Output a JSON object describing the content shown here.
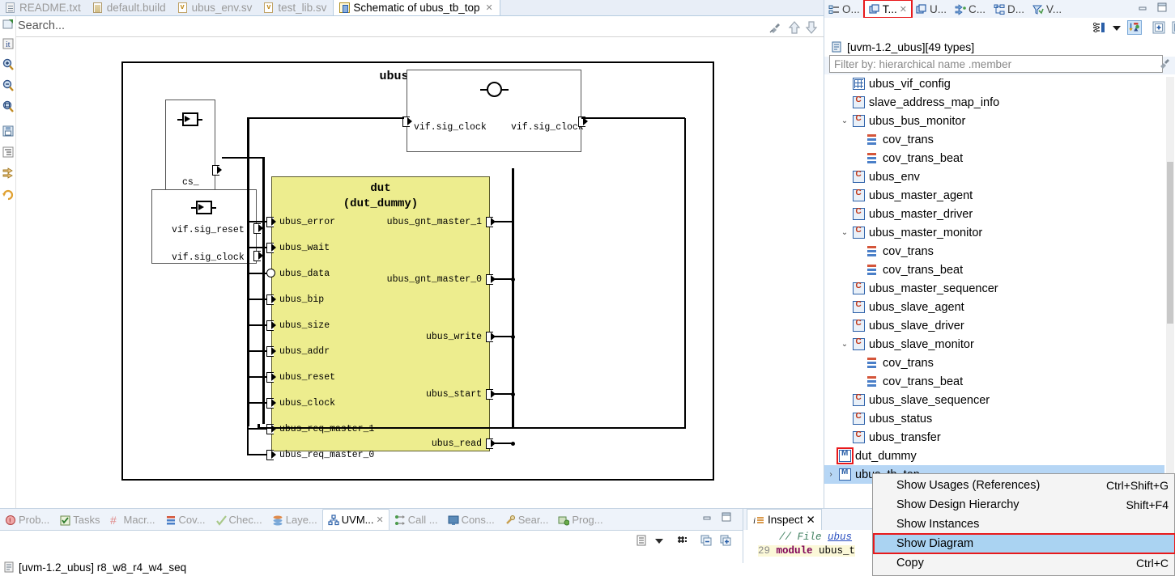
{
  "editor": {
    "tabs": [
      {
        "label": "README.txt",
        "icon": "text-file-icon",
        "active": false,
        "closable": false
      },
      {
        "label": "default.build",
        "icon": "build-file-icon",
        "active": false,
        "closable": false
      },
      {
        "label": "ubus_env.sv",
        "icon": "systemverilog-file-icon",
        "active": false,
        "closable": false
      },
      {
        "label": "test_lib.sv",
        "icon": "systemverilog-file-icon",
        "active": false,
        "closable": false
      },
      {
        "label": "Schematic of ubus_tb_top",
        "icon": "schematic-icon",
        "active": true,
        "closable": true
      }
    ],
    "search_placeholder": "Search...",
    "toolbar_icons": [
      "pin-icon",
      "arrow-up-icon",
      "arrow-down-icon"
    ],
    "left_tools": [
      "pin-editor-icon",
      "info-icon",
      "zoom-in-icon",
      "zoom-out-icon",
      "zoom-fit-icon",
      "save-icon",
      "outline-icon",
      "expand-icon",
      "refresh-icon"
    ]
  },
  "schematic": {
    "title": "ubus_tb_top",
    "dut": {
      "name": "dut",
      "type": "(dut_dummy)",
      "inputs": [
        "ubus_error",
        "ubus_wait",
        "ubus_data",
        "ubus_bip",
        "ubus_size",
        "ubus_addr",
        "ubus_reset",
        "ubus_clock",
        "ubus_req_master_1",
        "ubus_req_master_0"
      ],
      "outputs": [
        "ubus_gnt_master_1",
        "ubus_gnt_master_0",
        "ubus_write",
        "ubus_start",
        "ubus_read"
      ]
    },
    "blocks": [
      {
        "id": "cs-block",
        "symbol": "interface-icon",
        "labels": [
          "cs_"
        ]
      },
      {
        "id": "vif-block",
        "symbol": "interface-icon",
        "labels": [
          "vif.sig_reset",
          "vif.sig_clock"
        ]
      },
      {
        "id": "clock-block",
        "symbol": "clock-icon",
        "labels_left": [
          "vif.sig_clock"
        ],
        "labels_right": [
          "vif.sig_clock"
        ]
      }
    ],
    "dut_fill_color": "#eded8e"
  },
  "bottom": {
    "tabs": [
      {
        "label": "Prob...",
        "icon": "problems-icon",
        "active": false
      },
      {
        "label": "Tasks",
        "icon": "tasks-icon",
        "active": false
      },
      {
        "label": "Macr...",
        "icon": "macros-icon",
        "active": false
      },
      {
        "label": "Cov...",
        "icon": "coverage-icon",
        "active": false
      },
      {
        "label": "Chec...",
        "icon": "checks-icon",
        "active": false
      },
      {
        "label": "Laye...",
        "icon": "layers-icon",
        "active": false
      },
      {
        "label": "UVM...",
        "icon": "uvm-icon",
        "active": true
      },
      {
        "label": "Call ...",
        "icon": "call-hierarchy-icon",
        "active": false
      },
      {
        "label": "Cons...",
        "icon": "console-icon",
        "active": false
      },
      {
        "label": "Sear...",
        "icon": "search-icon",
        "active": false
      },
      {
        "label": "Prog...",
        "icon": "progress-icon",
        "active": false
      }
    ],
    "toolbar_icons": [
      "list-view-icon",
      "chevron-down-icon",
      "grid-icon",
      "collapse-all-icon",
      "expand-all-icon"
    ],
    "window_icons": [
      "minimize-icon",
      "maximize-icon"
    ]
  },
  "inspect": {
    "tab_label": "Inspect",
    "tab_icon": "inspect-icon",
    "code": {
      "comment": "// File ",
      "comment_link": "ubus",
      "line_number": "29",
      "keyword": "module",
      "rest": " ubus_t"
    }
  },
  "status": {
    "icon": "project-icon",
    "text": "[uvm-1.2_ubus] r8_w8_r4_w4_seq"
  },
  "right_panel": {
    "tabs": [
      {
        "label": "O...",
        "icon": "outline-icon",
        "active": false,
        "closable": false
      },
      {
        "label": "T...",
        "icon": "types-icon",
        "active": true,
        "closable": true
      },
      {
        "label": "U...",
        "icon": "uvm-types-icon",
        "active": false,
        "closable": false
      },
      {
        "label": "C...",
        "icon": "compile-order-icon",
        "active": false,
        "closable": false
      },
      {
        "label": "D...",
        "icon": "design-hierarchy-icon",
        "active": false,
        "closable": false
      },
      {
        "label": "V...",
        "icon": "verification-icon",
        "active": false,
        "closable": false
      }
    ],
    "toolbar_icons": [
      "filter-sort-icon",
      "chevron-down-icon",
      "sort-by-icon",
      "expand-all-icon",
      "collapse-all-icon"
    ],
    "window_icons": [
      "minimize-icon",
      "maximize-icon"
    ],
    "header": {
      "icon": "project-icon",
      "text": "[uvm-1.2_ubus][49 types]"
    },
    "filter_placeholder": "Filter by: hierarchical name .member",
    "tree": [
      {
        "label": "ubus_vif_config",
        "icon": "grid-icon",
        "depth": 1,
        "arrow": "",
        "selected": false
      },
      {
        "label": "slave_address_map_info",
        "icon": "class-icon",
        "depth": 1,
        "arrow": "",
        "selected": false
      },
      {
        "label": "ubus_bus_monitor",
        "icon": "class-icon",
        "depth": 1,
        "arrow": "expanded",
        "selected": false
      },
      {
        "label": "cov_trans",
        "icon": "coverage-icon",
        "depth": 2,
        "arrow": "",
        "selected": false
      },
      {
        "label": "cov_trans_beat",
        "icon": "coverage-icon",
        "depth": 2,
        "arrow": "",
        "selected": false
      },
      {
        "label": "ubus_env",
        "icon": "class-icon",
        "depth": 1,
        "arrow": "",
        "selected": false
      },
      {
        "label": "ubus_master_agent",
        "icon": "class-icon",
        "depth": 1,
        "arrow": "",
        "selected": false
      },
      {
        "label": "ubus_master_driver",
        "icon": "class-icon",
        "depth": 1,
        "arrow": "",
        "selected": false
      },
      {
        "label": "ubus_master_monitor",
        "icon": "class-icon",
        "depth": 1,
        "arrow": "expanded",
        "selected": false
      },
      {
        "label": "cov_trans",
        "icon": "coverage-icon",
        "depth": 2,
        "arrow": "",
        "selected": false
      },
      {
        "label": "cov_trans_beat",
        "icon": "coverage-icon",
        "depth": 2,
        "arrow": "",
        "selected": false
      },
      {
        "label": "ubus_master_sequencer",
        "icon": "class-icon",
        "depth": 1,
        "arrow": "",
        "selected": false
      },
      {
        "label": "ubus_slave_agent",
        "icon": "class-icon",
        "depth": 1,
        "arrow": "",
        "selected": false
      },
      {
        "label": "ubus_slave_driver",
        "icon": "class-icon",
        "depth": 1,
        "arrow": "",
        "selected": false
      },
      {
        "label": "ubus_slave_monitor",
        "icon": "class-icon",
        "depth": 1,
        "arrow": "expanded",
        "selected": false
      },
      {
        "label": "cov_trans",
        "icon": "coverage-icon",
        "depth": 2,
        "arrow": "",
        "selected": false
      },
      {
        "label": "cov_trans_beat",
        "icon": "coverage-icon",
        "depth": 2,
        "arrow": "",
        "selected": false
      },
      {
        "label": "ubus_slave_sequencer",
        "icon": "class-icon",
        "depth": 1,
        "arrow": "",
        "selected": false
      },
      {
        "label": "ubus_status",
        "icon": "class-icon",
        "depth": 1,
        "arrow": "",
        "selected": false
      },
      {
        "label": "ubus_transfer",
        "icon": "class-icon",
        "depth": 1,
        "arrow": "",
        "selected": false
      },
      {
        "label": "dut_dummy",
        "icon": "module-icon",
        "depth": 0,
        "arrow": "",
        "selected": false,
        "highlighted": true
      },
      {
        "label": "ubus_tb_top",
        "icon": "module-icon",
        "depth": 0,
        "arrow": "collapsed",
        "selected": true
      }
    ]
  },
  "context_menu": {
    "items": [
      {
        "label": "Show Usages (References)",
        "accel": "Ctrl+Shift+G",
        "highlighted": false
      },
      {
        "label": "Show Design Hierarchy",
        "accel": "Shift+F4",
        "highlighted": false
      },
      {
        "label": "Show Instances",
        "accel": "",
        "highlighted": false
      },
      {
        "label": "Show Diagram",
        "accel": "",
        "highlighted": true
      },
      {
        "label": "Copy",
        "accel": "Ctrl+C",
        "highlighted": false
      }
    ]
  },
  "colors": {
    "accent": "#2a5fa8",
    "highlight_red": "#e8191b",
    "menu_highlight": "#aad3f2",
    "tree_selection": "#b6d6f5",
    "dut_fill": "#eded8e"
  }
}
